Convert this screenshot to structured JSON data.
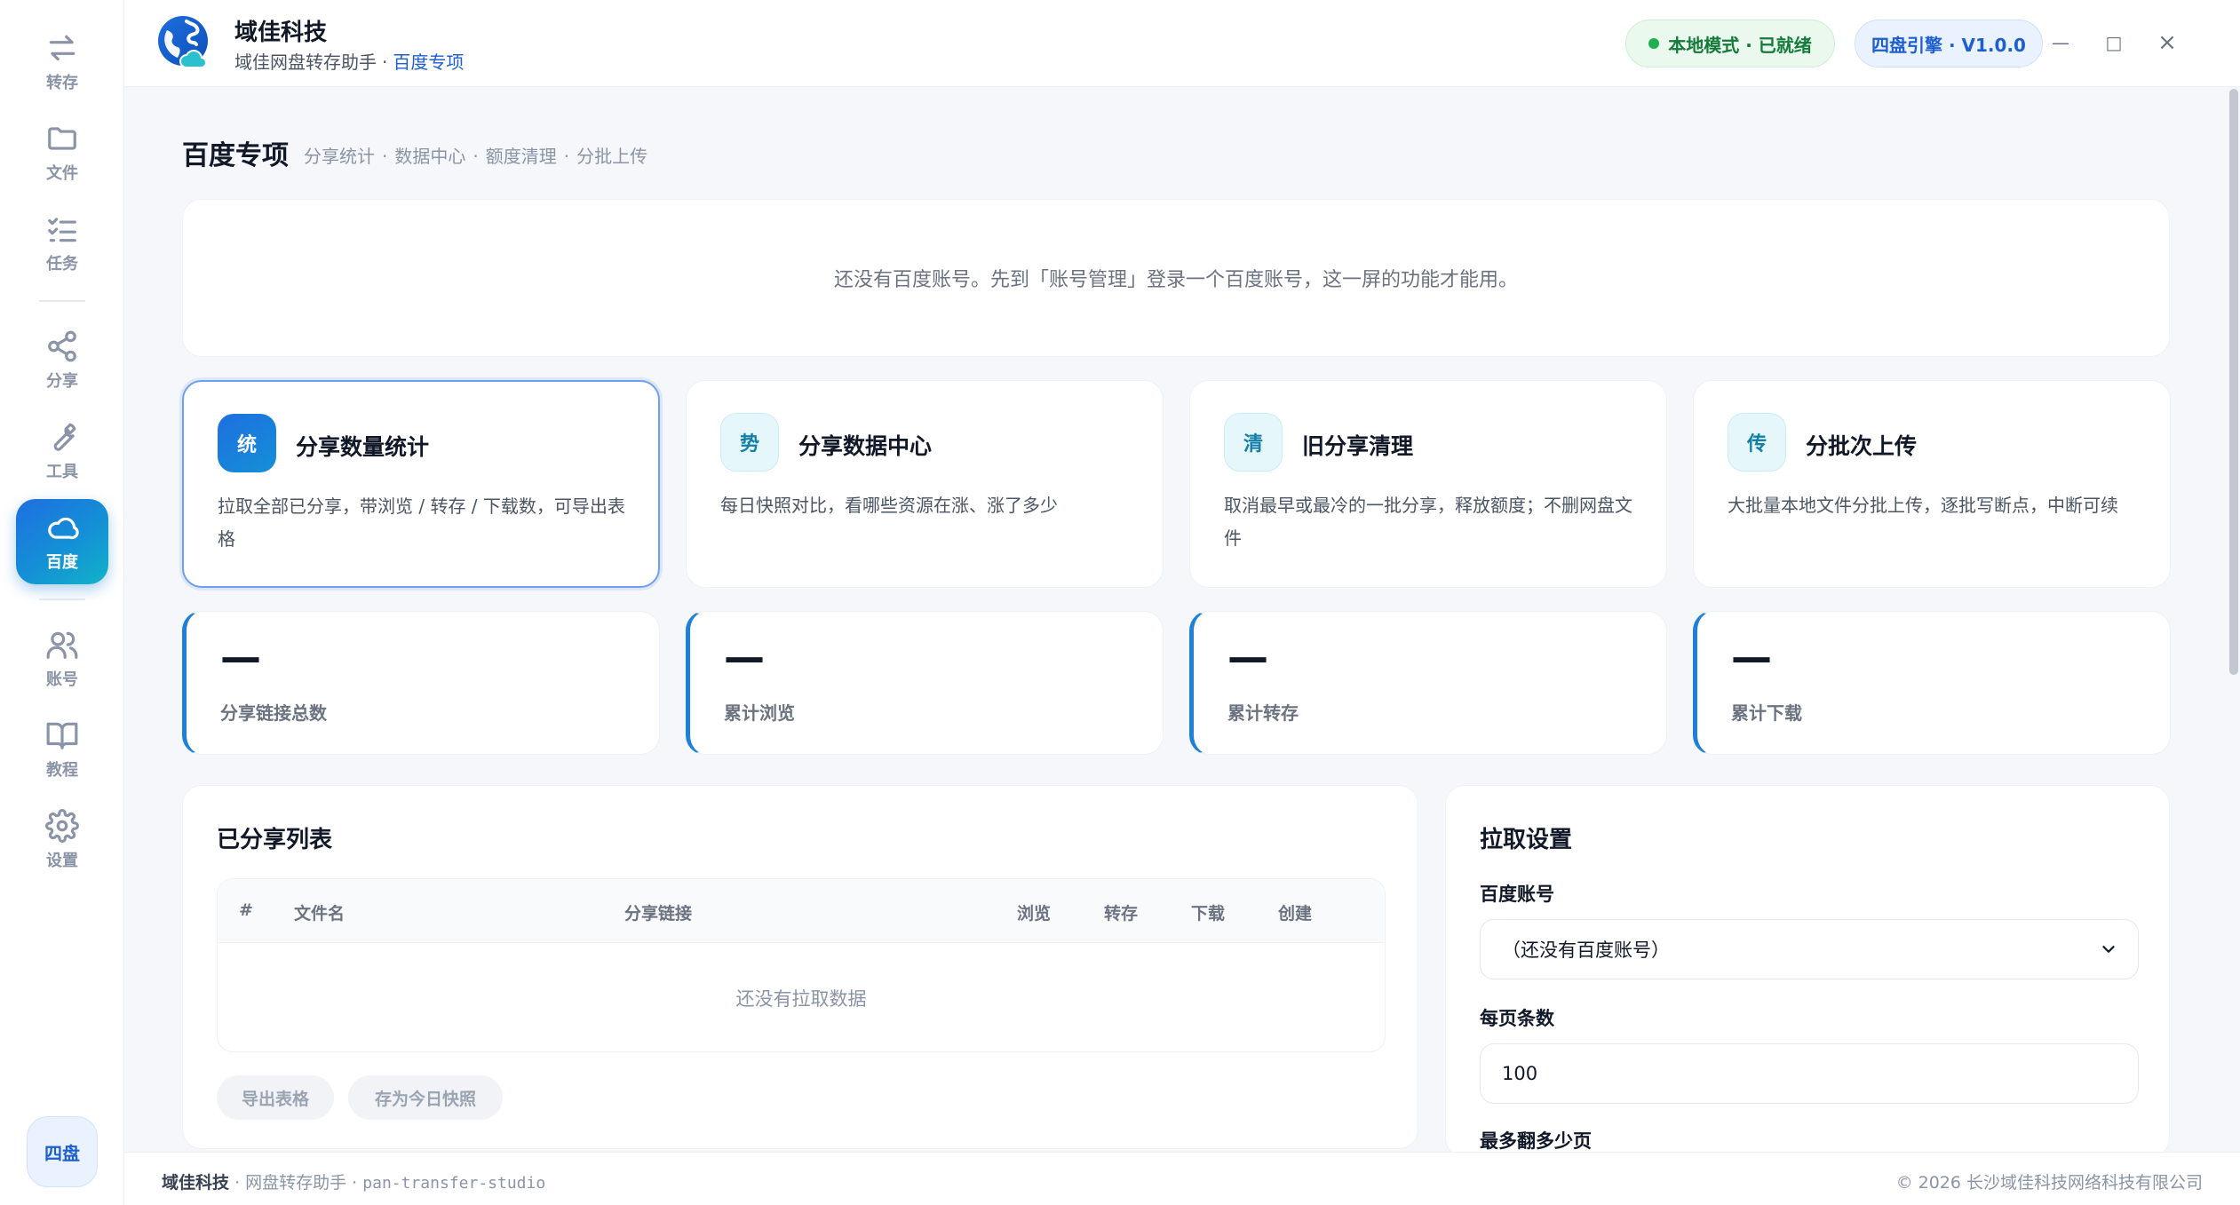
{
  "sidebar": {
    "items": [
      {
        "label": "转存",
        "icon": "transfer-icon"
      },
      {
        "label": "文件",
        "icon": "folder-icon"
      },
      {
        "label": "任务",
        "icon": "task-list-icon"
      },
      {
        "label": "分享",
        "icon": "share-icon"
      },
      {
        "label": "工具",
        "icon": "wrench-icon"
      },
      {
        "label": "百度",
        "icon": "cloud-icon",
        "active": true
      },
      {
        "label": "账号",
        "icon": "users-icon"
      },
      {
        "label": "教程",
        "icon": "book-icon"
      },
      {
        "label": "设置",
        "icon": "gear-icon"
      }
    ],
    "brand_badge": "四盘"
  },
  "header": {
    "app_name": "域佳科技",
    "subtitle": "域佳网盘转存助手",
    "subtitle_dot": "·",
    "subtitle_accent": "百度专项",
    "status_pill": "本地模式 · 已就绪",
    "engine_pill": "四盘引擎 · V1.0.0",
    "window_controls": {
      "minimize": "—",
      "maximize": "□",
      "close": "×"
    }
  },
  "page": {
    "title": "百度专项",
    "tabs": [
      "分享统计",
      "数据中心",
      "额度清理",
      "分批上传"
    ],
    "tab_sep": "·",
    "notice": "还没有百度账号。先到「账号管理」登录一个百度账号，这一屏的功能才能用。"
  },
  "features": [
    {
      "badge": "统",
      "title": "分享数量统计",
      "desc": "拉取全部已分享，带浏览 / 转存 / 下载数，可导出表格",
      "selected": true
    },
    {
      "badge": "势",
      "title": "分享数据中心",
      "desc": "每日快照对比，看哪些资源在涨、涨了多少"
    },
    {
      "badge": "清",
      "title": "旧分享清理",
      "desc": "取消最早或最冷的一批分享，释放额度；不删网盘文件"
    },
    {
      "badge": "传",
      "title": "分批次上传",
      "desc": "大批量本地文件分批上传，逐批写断点，中断可续"
    }
  ],
  "stats": [
    {
      "value": "—",
      "label": "分享链接总数"
    },
    {
      "value": "—",
      "label": "累计浏览"
    },
    {
      "value": "—",
      "label": "累计转存"
    },
    {
      "value": "—",
      "label": "累计下载"
    }
  ],
  "share_list": {
    "title": "已分享列表",
    "columns": [
      "#",
      "文件名",
      "分享链接",
      "浏览",
      "转存",
      "下载",
      "创建"
    ],
    "empty": "还没有拉取数据",
    "export_button": "导出表格",
    "snapshot_button": "存为今日快照"
  },
  "settings": {
    "title": "拉取设置",
    "account_label": "百度账号",
    "account_value": "（还没有百度账号）",
    "page_size_label": "每页条数",
    "page_size_value": "100",
    "max_pages_label": "最多翻多少页"
  },
  "footer": {
    "brand": "域佳科技",
    "product": "· 网盘转存助手 ·",
    "code": "pan-transfer-studio",
    "copyright": "© 2026 长沙域佳科技网络科技有限公司"
  },
  "colors": {
    "accent": "#1e6fe0",
    "active_gradient_end": "#12b3c9",
    "status_green": "#1fb14f",
    "stat_border": "#1e80d8"
  }
}
